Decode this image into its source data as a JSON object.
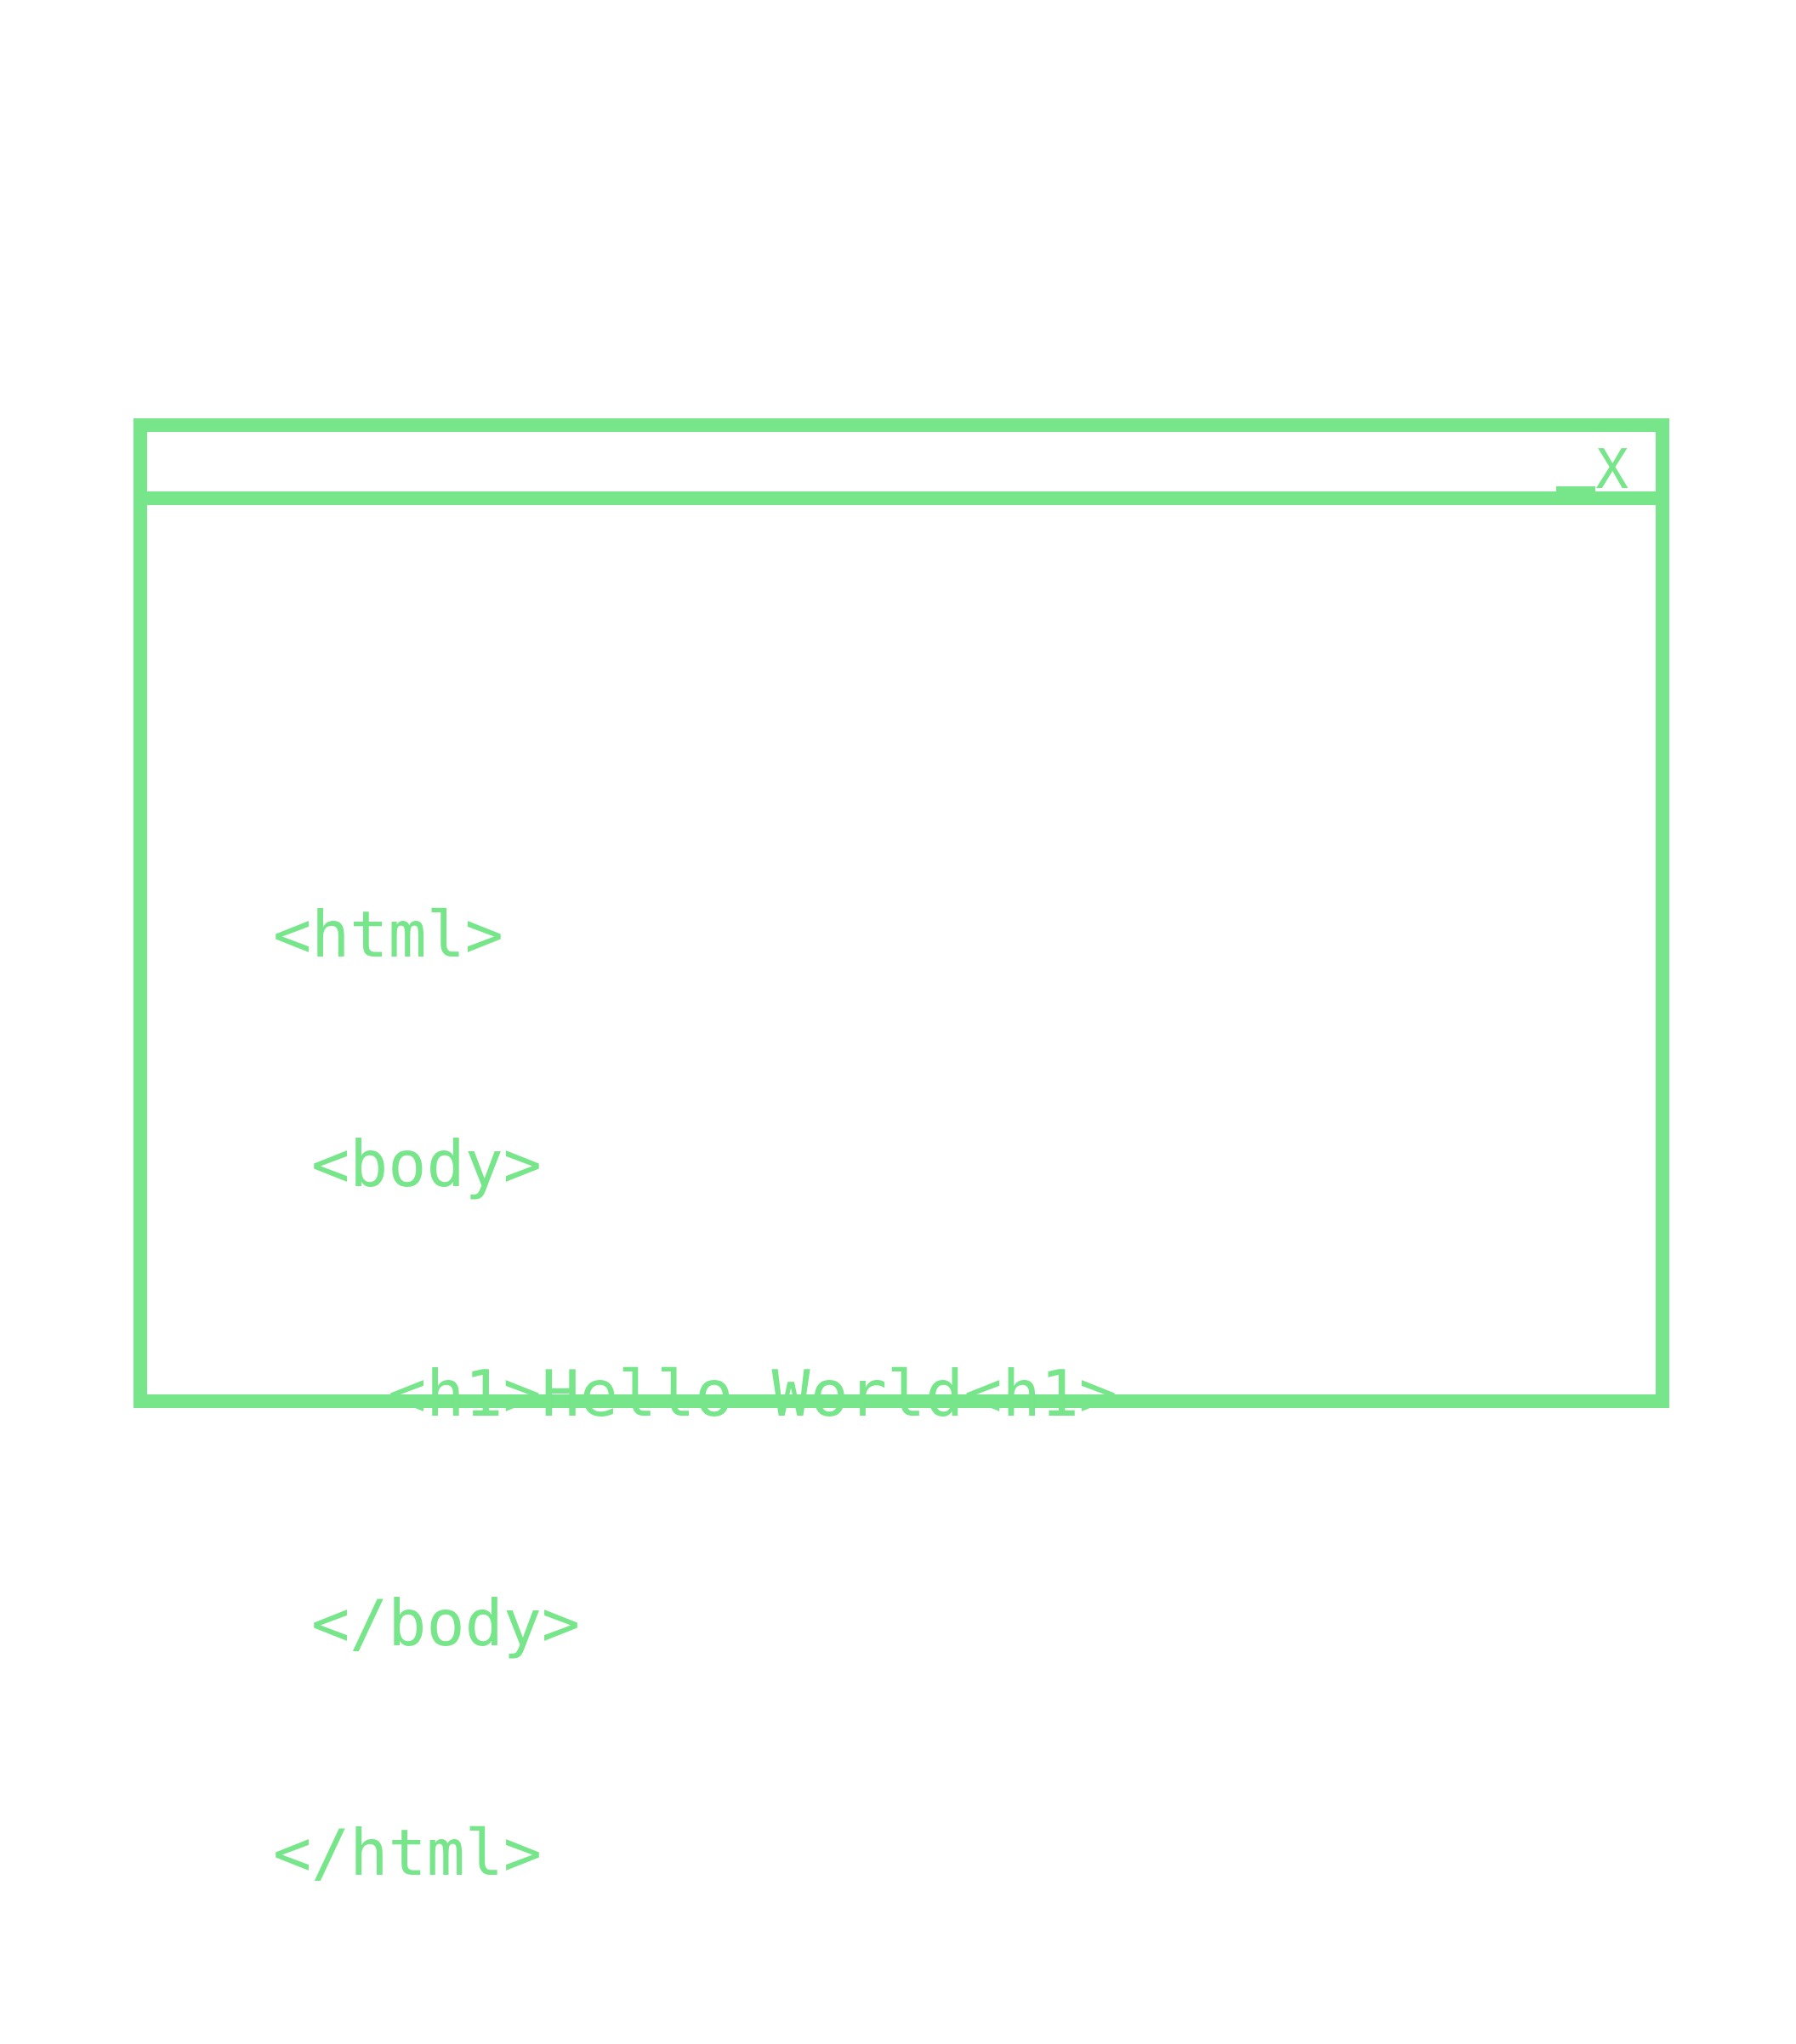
{
  "theme": {
    "accent": "#77e589",
    "background": "#ffffff"
  },
  "window": {
    "controls": {
      "minimize_icon": "minimize-icon",
      "close_label": "X"
    }
  },
  "code": {
    "lines": [
      {
        "indent": 0,
        "text": "<html>"
      },
      {
        "indent": 1,
        "text": "<body>"
      },
      {
        "indent": 3,
        "text": "<h1>Hello World<h1>"
      },
      {
        "indent": 1,
        "text": "</body>"
      },
      {
        "indent": 0,
        "text": "</html>"
      }
    ]
  }
}
